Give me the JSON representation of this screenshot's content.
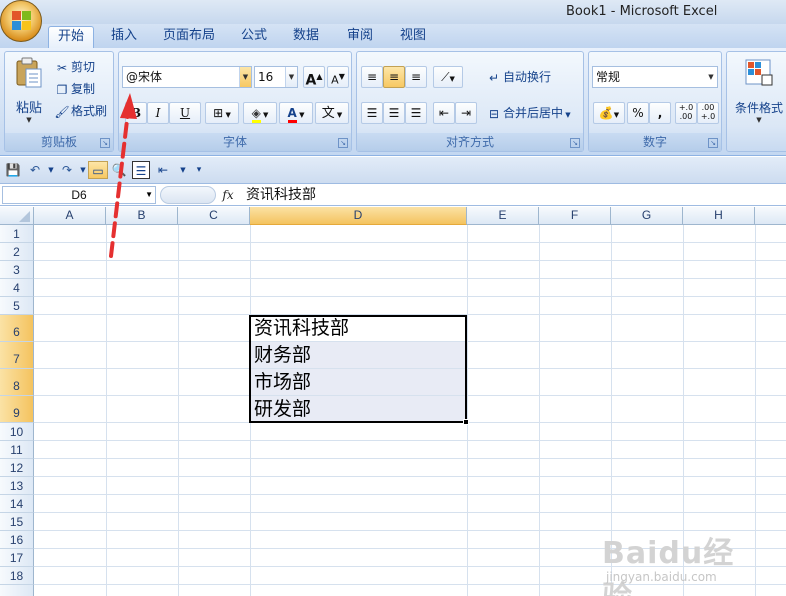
{
  "window": {
    "title": "Book1 - Microsoft Excel"
  },
  "tabs": [
    "开始",
    "插入",
    "页面布局",
    "公式",
    "数据",
    "审阅",
    "视图"
  ],
  "active_tab": "开始",
  "ribbon": {
    "clipboard": {
      "label": "剪贴板",
      "paste": "粘贴",
      "cut": "剪切",
      "copy": "复制",
      "format_painter": "格式刷"
    },
    "font": {
      "label": "字体",
      "font_name": "@宋体",
      "font_size": "16",
      "bold": "B",
      "italic": "I",
      "underline": "U",
      "grow": "A",
      "shrink": "A",
      "phonetic": "文"
    },
    "alignment": {
      "label": "对齐方式",
      "wrap_text": "自动换行",
      "merge_center": "合并后居中"
    },
    "number": {
      "label": "数字",
      "format": "常规",
      "percent": "%",
      "comma": ",",
      "inc_decimal": "+.0 .00",
      "dec_decimal": ".00 +.0"
    },
    "styles": {
      "conditional_format": "条件格式"
    }
  },
  "formula_bar": {
    "name_box": "D6",
    "fx": "fx",
    "content": "资讯科技部"
  },
  "columns": [
    "A",
    "B",
    "C",
    "D",
    "E",
    "F",
    "G",
    "H"
  ],
  "rows": [
    "1",
    "2",
    "3",
    "4",
    "5",
    "6",
    "7",
    "8",
    "9",
    "10",
    "11",
    "12",
    "13",
    "14",
    "15",
    "16",
    "17",
    "18"
  ],
  "cells": {
    "D6": "资讯科技部",
    "D7": "财务部",
    "D8": "市场部",
    "D9": "研发部"
  },
  "colors": {
    "selection_header": "#f4c35f",
    "arrow": "#e53030",
    "range_fill": "#e8ebf5"
  },
  "watermark": {
    "brand": "Baidu经验",
    "url": "jingyan.baidu.com"
  }
}
